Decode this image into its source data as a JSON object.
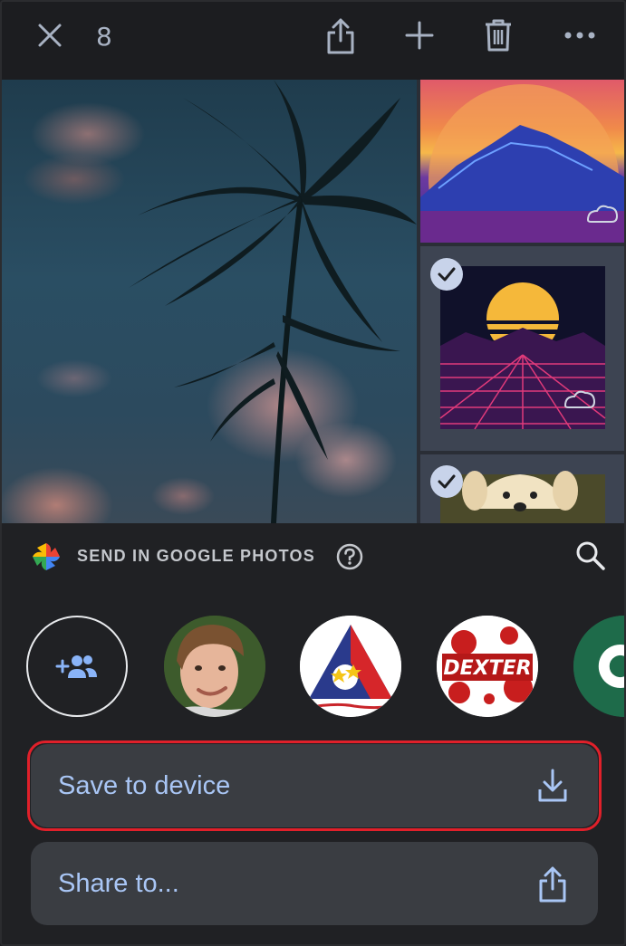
{
  "topbar": {
    "selected_count": "8",
    "icons": [
      "close-icon",
      "share-icon",
      "add-icon",
      "trash-icon",
      "more-icon"
    ]
  },
  "sheet": {
    "title": "SEND IN GOOGLE PHOTOS",
    "contacts": [
      "add-people-icon",
      "contact-photo",
      "contact-logo",
      "contact-dexter",
      "contact-partial"
    ],
    "dexter_text": "DEXTER",
    "actions": {
      "save": "Save to device",
      "share": "Share to..."
    }
  },
  "colors": {
    "background": "#202124",
    "action_text": "#a9c6f5",
    "highlight": "#e0202a",
    "icon": "#a8b2c3"
  }
}
